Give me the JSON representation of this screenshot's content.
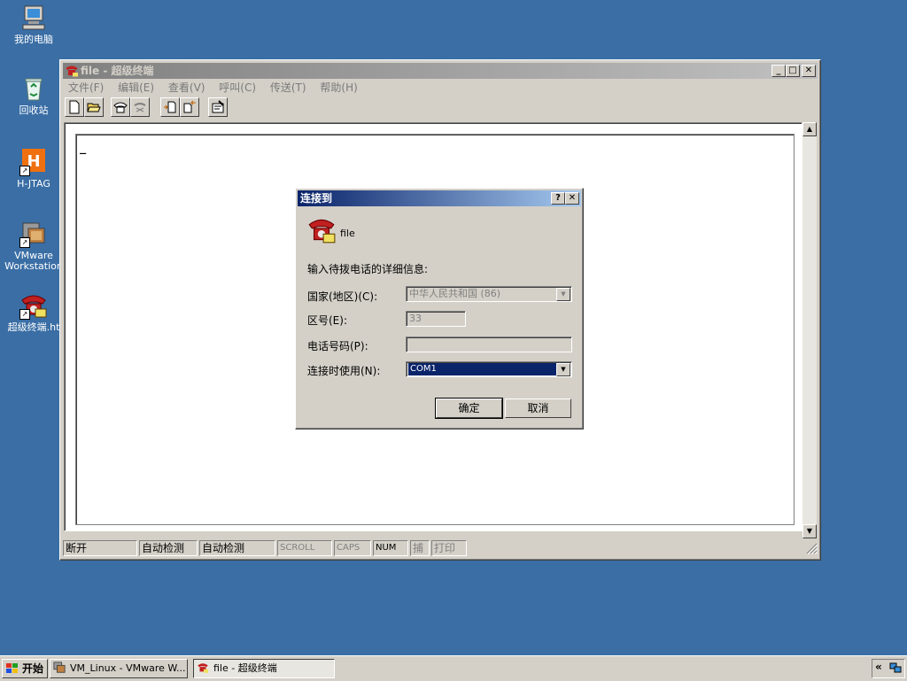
{
  "desktop": {
    "icons": [
      {
        "label": "我的电脑"
      },
      {
        "label": "回收站"
      },
      {
        "label": "H-JTAG"
      },
      {
        "label": "VMware Workstation"
      },
      {
        "label": "超级终端.ht"
      }
    ]
  },
  "window": {
    "title": "file - 超级终端",
    "controls": {
      "minimize": "_",
      "maximize": "□",
      "close": "✕"
    },
    "menu": [
      "文件(F)",
      "编辑(E)",
      "查看(V)",
      "呼叫(C)",
      "传送(T)",
      "帮助(H)"
    ],
    "cursor": "_",
    "status": {
      "connection": "断开",
      "detect1": "自动检测",
      "detect2": "自动检测",
      "scroll": "SCROLL",
      "caps": "CAPS",
      "num": "NUM",
      "capture": "捕",
      "print": "打印"
    }
  },
  "dialog": {
    "title": "连接到",
    "help_btn": "?",
    "close_btn": "✕",
    "connection_name": "file",
    "prompt": "输入待拨电话的详细信息:",
    "country_label": "国家(地区)(C):",
    "country_value": "中华人民共和国 (86)",
    "area_label": "区号(E):",
    "area_value": "33",
    "phone_label": "电话号码(P):",
    "phone_value": "",
    "connect_using_label": "连接时使用(N):",
    "connect_using_value": "COM1",
    "ok": "确定",
    "cancel": "取消"
  },
  "taskbar": {
    "start": "开始",
    "tasks": [
      {
        "label": "VM_Linux - VMware W..."
      },
      {
        "label": "file - 超级终端"
      }
    ],
    "tray_arrows": "«"
  },
  "colors": {
    "desktop": "#3a6ea5",
    "active_title": "#0a246a",
    "face": "#d4d0c8",
    "selection": "#0a246a"
  }
}
